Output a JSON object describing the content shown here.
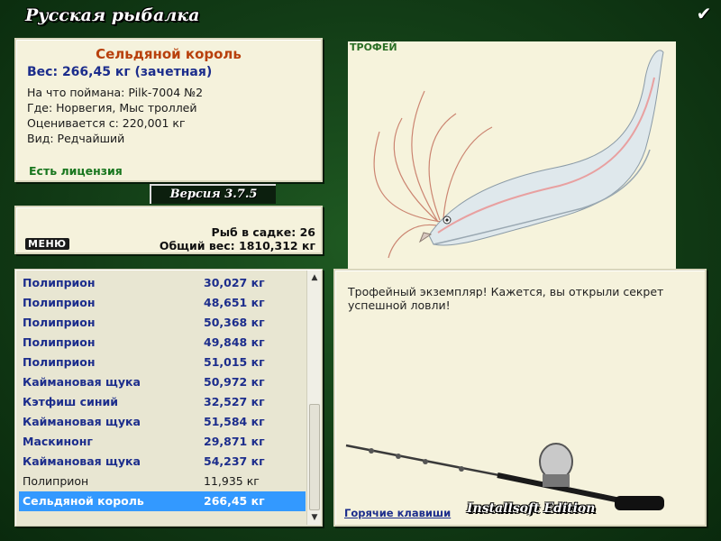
{
  "app": {
    "title": "Русская рыбалка",
    "ok_icon": "checkmark-icon"
  },
  "fish": {
    "name": "Сельдяной король",
    "weight": "Вес: 266,45 кг (зачетная)",
    "lines": [
      "На что поймана: Pilk-7004 №2",
      "Где: Норвегия, Мыс троллей",
      "Оценивается с: 220,001 кг",
      "Вид: Редчайший"
    ],
    "license": "Есть лицензия"
  },
  "version": "Версия 3.7.5",
  "menu_label": "МЕНЮ",
  "stats": {
    "fish_count": "Рыб в садке: 26",
    "total_weight": "Общий вес: 1810,312 кг"
  },
  "catch_list": [
    {
      "name": "Полиприон",
      "weight": "30,027 кг"
    },
    {
      "name": "Полиприон",
      "weight": "48,651 кг"
    },
    {
      "name": "Полиприон",
      "weight": "50,368 кг"
    },
    {
      "name": "Полиприон",
      "weight": "49,848 кг"
    },
    {
      "name": "Полиприон",
      "weight": "51,015 кг"
    },
    {
      "name": "Каймановая щука",
      "weight": "50,972 кг"
    },
    {
      "name": "Кэтфиш синий",
      "weight": "32,527 кг"
    },
    {
      "name": "Каймановая щука",
      "weight": "51,584 кг"
    },
    {
      "name": "Маскинонг",
      "weight": "29,871 кг"
    },
    {
      "name": "Каймановая щука",
      "weight": "54,237 кг"
    },
    {
      "name": "Полиприон",
      "weight": "11,935 кг"
    },
    {
      "name": "Сельдяной король",
      "weight": "266,45 кг"
    }
  ],
  "trophy_label": "ТРОФЕЙ",
  "message": "Трофейный экземпляр! Кажется, вы открыли секрет успешной ловли!",
  "hotkeys": "Горячие клавиши",
  "edition": "Installsoft Edition",
  "colors": {
    "accent_blue": "#1c2d8c",
    "fish_name": "#b8400c",
    "license": "#18761e",
    "selection": "#3399ff",
    "background": "#0f3a14"
  }
}
